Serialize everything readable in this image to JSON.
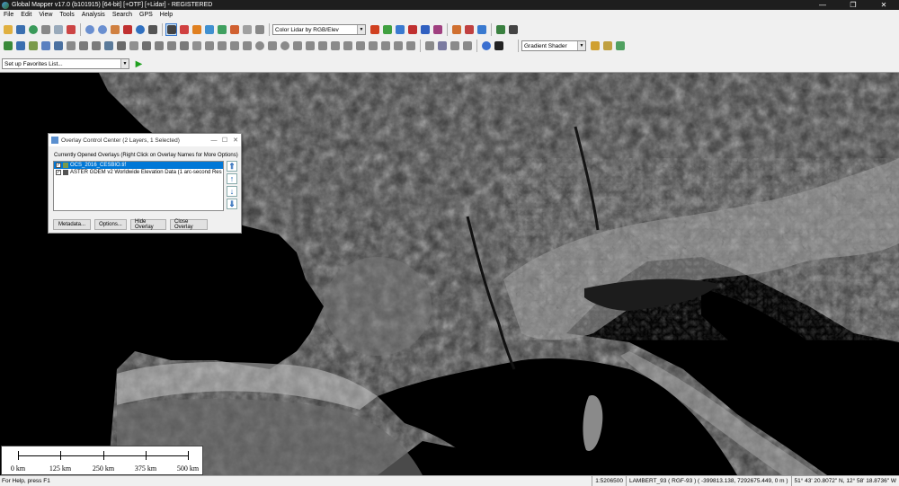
{
  "window": {
    "title": "Global Mapper v17.0 (b101915) [64-bit] [+OTF] [+Lidar] - REGISTERED",
    "minimize": "—",
    "maximize": "❐",
    "close": "✕"
  },
  "menu": [
    "File",
    "Edit",
    "View",
    "Tools",
    "Analysis",
    "Search",
    "GPS",
    "Help"
  ],
  "toolbar": {
    "shader_mode": "Color Lidar by RGB/Elev",
    "shader": "Gradient Shader",
    "favorites": "Set up Favorites List...",
    "run_icon": "▶"
  },
  "overlay_control_center": {
    "title": "Overlay Control Center (2 Layers, 1 Selected)",
    "header": "Currently Opened Overlays (Right Click on Overlay Names for More Options)",
    "layers": [
      {
        "name": "OCS_2016_CESBIO.tif",
        "checked": true,
        "selected": true
      },
      {
        "name": "ASTER GDEM v2 Worldwide Elevation Data (1 arc-second Res",
        "checked": true,
        "selected": false
      }
    ],
    "buttons": {
      "metadata": "Metadata...",
      "options": "Options...",
      "hide": "Hide Overlay",
      "close": "Close Overlay"
    },
    "arrows": [
      "⇑",
      "↑",
      "↓",
      "⇓"
    ]
  },
  "scale_bar": {
    "labels": [
      "0 km",
      "125 km",
      "250 km",
      "375 km",
      "500 km"
    ]
  },
  "status": {
    "help": "For Help, press F1",
    "scale": "1:5206500",
    "projection": "LAMBERT_93 ( RGF-93 ) ( -399813.138, 7292675.449, 0 m )",
    "coords": "51° 43' 20.8072\" N, 12° 58' 18.8736\" W"
  }
}
